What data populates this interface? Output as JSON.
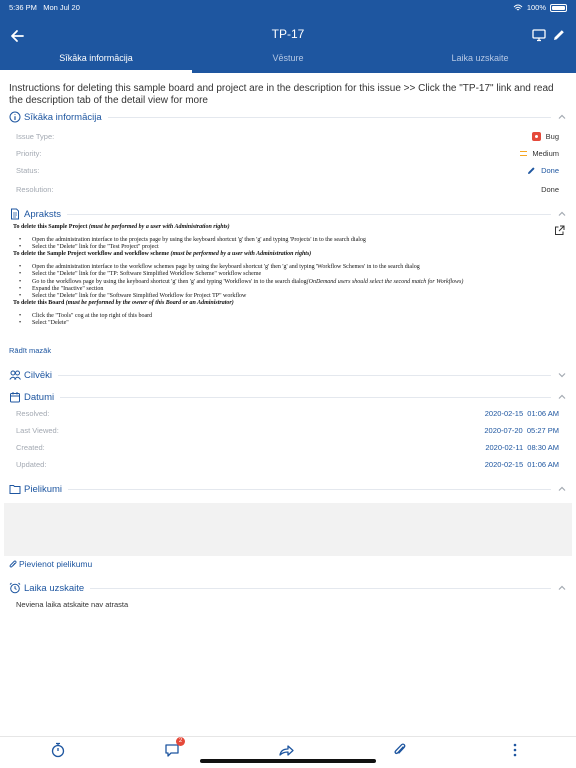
{
  "status_bar": {
    "time": "5:36 PM",
    "date": "Mon Jul 20",
    "battery": "100%"
  },
  "header": {
    "title": "TP-17"
  },
  "tabs": [
    {
      "label": "Sīkāka informācija"
    },
    {
      "label": "Vēsture"
    },
    {
      "label": "Laika uzskaite"
    }
  ],
  "intro_text": "Instructions for deleting this sample board and project are in the description for this issue >> Click the \"TP-17\" link and read the description tab of the detail view for more",
  "details": {
    "heading": "Sīkāka informācija",
    "rows": [
      {
        "label": "Issue Type:",
        "value": "Bug"
      },
      {
        "label": "Priority:",
        "value": "Medium"
      },
      {
        "label": "Status:",
        "value": "Done"
      },
      {
        "label": "Resolution:",
        "value": "Done"
      }
    ]
  },
  "description": {
    "heading": "Apraksts",
    "blocks": [
      {
        "title": "To delete this Sample Project",
        "note": "(must be performed by a user with Administration rights)",
        "items": [
          "Open the administration interface to the projects page by using the keyboard shortcut 'g' then 'g' and typing 'Projects' in to the search dialog",
          "Select the \"Delete\" link for the \"Test Project\" project"
        ]
      },
      {
        "title": "To delete the Sample Project workflow and workflow scheme",
        "note": "(must be performed by a user with Administration rights)",
        "items": [
          "Open the administration interface to the workflow schemes page by using the keyboard shortcut 'g' then 'g' and typing 'Workflow Schemes' in to the search dialog",
          "Select the \"Delete\" link for the \"TP: Software Simplified Workflow Scheme\" workflow scheme",
          "Go to the workflows page by using the keyboard shortcut 'g' then 'g' and typing 'Workflows' in to the search dialog(OnDemand users should select the second match for Workflows)",
          "Expand the \"Inactive\" section",
          "Select the \"Delete\" link for the \"Software Simplified Workflow for Project TP\" workflow"
        ]
      },
      {
        "title": "To delete this Board",
        "note": "(must be performed by the owner of this Board or an Administrator)",
        "items": [
          "Click the \"Tools\" cog at the top right of this board",
          "Select \"Delete\""
        ]
      }
    ],
    "show_less": "Rādīt mazāk"
  },
  "people": {
    "heading": "Cilvēki"
  },
  "dates": {
    "heading": "Datumi",
    "rows": [
      {
        "label": "Resolved:",
        "value": "2020-02-15  01:06 AM"
      },
      {
        "label": "Last Viewed:",
        "value": "2020-07-20  05:27 PM"
      },
      {
        "label": "Created:",
        "value": "2020-02-11  08:30 AM"
      },
      {
        "label": "Updated:",
        "value": "2020-02-15  01:06 AM"
      }
    ]
  },
  "attachments": {
    "heading": "Pielikumi",
    "add_label": "Pievienot pielikumu"
  },
  "time_tracking": {
    "heading": "Laika uzskaite",
    "empty_text": "Neviena laika atskaite nav atrasta"
  },
  "bottom_bar": {
    "comments_badge": "2"
  },
  "colors": {
    "brand": "#1e56a0",
    "bug": "#e5493a",
    "priority_medium": "#f5a623"
  },
  "icons": [
    "back-arrow-icon",
    "monitor-icon",
    "pencil-icon",
    "info-icon",
    "document-icon",
    "people-icon",
    "calendar-icon",
    "folder-icon",
    "paperclip-icon",
    "alarm-clock-icon",
    "timer-icon",
    "comment-icon",
    "share-icon",
    "more-icon",
    "external-link-icon",
    "chevron-up-icon",
    "chevron-down-icon"
  ]
}
